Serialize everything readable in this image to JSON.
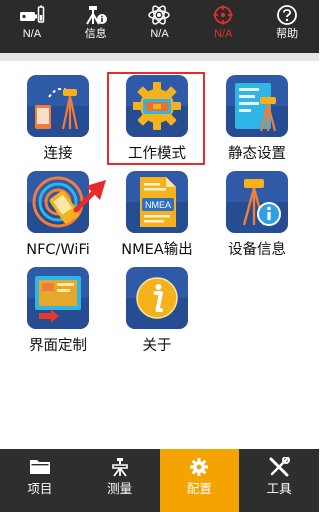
{
  "status_bar": {
    "items": [
      {
        "icon": "device-battery-icon",
        "label": "N/A"
      },
      {
        "icon": "surveyor-info-icon",
        "label": "信息"
      },
      {
        "icon": "satellite-atom-icon",
        "label": "N/A"
      },
      {
        "icon": "crosshair-target-icon",
        "label": "N/A",
        "color": "#e0302a"
      },
      {
        "icon": "help-question-icon",
        "label": "帮助"
      }
    ]
  },
  "grid": {
    "items": [
      {
        "icon": "connect-icon",
        "label": "连接"
      },
      {
        "icon": "work-mode-gear-icon",
        "label": "工作模式"
      },
      {
        "icon": "static-settings-icon",
        "label": "静态设置"
      },
      {
        "icon": "nfc-wifi-icon",
        "label": "NFC/WiFi"
      },
      {
        "icon": "nmea-file-icon",
        "label": "NMEA输出",
        "icon_text": "NMEA"
      },
      {
        "icon": "device-info-icon",
        "label": "设备信息"
      },
      {
        "icon": "interface-custom-icon",
        "label": "界面定制"
      },
      {
        "icon": "about-info-icon",
        "label": "关于"
      }
    ]
  },
  "bottom_nav": {
    "active_index": 2,
    "active_color": "#f4a300",
    "items": [
      {
        "icon": "folder-icon",
        "label": "项目"
      },
      {
        "icon": "survey-instrument-icon",
        "label": "测量"
      },
      {
        "icon": "config-gear-icon",
        "label": "配置"
      },
      {
        "icon": "tools-icon",
        "label": "工具"
      }
    ]
  }
}
